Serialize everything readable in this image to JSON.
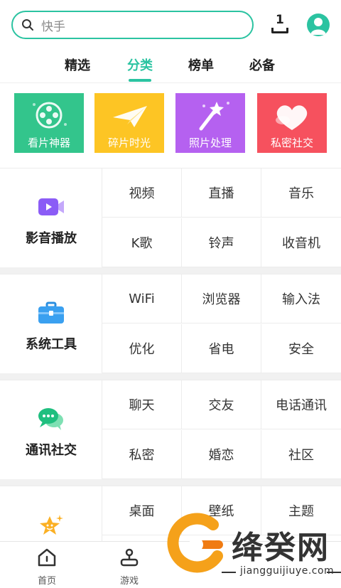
{
  "search": {
    "placeholder": "快手"
  },
  "download_count": "1",
  "tabs": [
    "精选",
    "分类",
    "榜单",
    "必备"
  ],
  "active_tab": "分类",
  "cards": [
    {
      "label": "看片神器",
      "color": "#33c58c",
      "icon": "film-reel-icon"
    },
    {
      "label": "碎片时光",
      "color": "#fdc524",
      "icon": "paper-plane-icon"
    },
    {
      "label": "照片处理",
      "color": "#b561f0",
      "icon": "magic-wand-icon"
    },
    {
      "label": "私密社交",
      "color": "#f6515e",
      "icon": "heart-icon"
    }
  ],
  "sections": [
    {
      "title": "影音播放",
      "icon": "video-camera-icon",
      "items": [
        "视频",
        "直播",
        "音乐",
        "K歌",
        "铃声",
        "收音机"
      ]
    },
    {
      "title": "系统工具",
      "icon": "toolbox-icon",
      "items": [
        "WiFi",
        "浏览器",
        "输入法",
        "优化",
        "省电",
        "安全"
      ]
    },
    {
      "title": "通讯社交",
      "icon": "chat-bubbles-icon",
      "items": [
        "聊天",
        "交友",
        "电话通讯",
        "私密",
        "婚恋",
        "社区"
      ]
    },
    {
      "title": "",
      "icon": "star-face-icon",
      "items": [
        "桌面",
        "壁纸",
        "主题"
      ]
    }
  ],
  "bottom_nav": [
    {
      "label": "首页",
      "icon": "home-icon"
    },
    {
      "label": "游戏",
      "icon": "joystick-icon"
    }
  ],
  "watermark": {
    "title": "绛癸网",
    "subtitle": "jiangguijiuye.com"
  },
  "colors": {
    "accent": "#2bc3a1"
  }
}
